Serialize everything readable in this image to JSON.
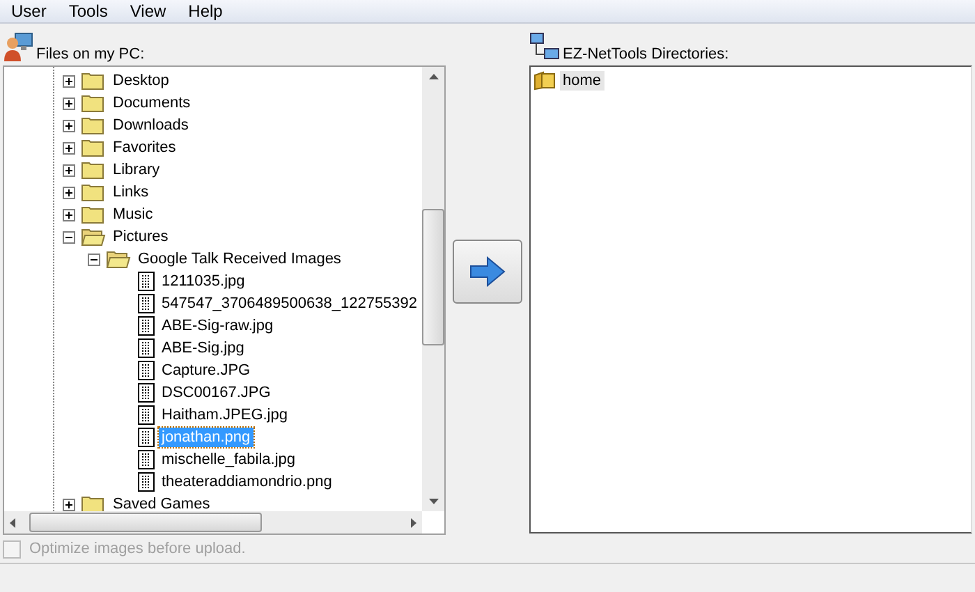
{
  "menu": [
    "User",
    "Tools",
    "View",
    "Help"
  ],
  "left_panel": {
    "label": "Files on my PC:",
    "tree": [
      {
        "label": "Desktop",
        "kind": "folder",
        "expanded": false,
        "selected": false
      },
      {
        "label": "Documents",
        "kind": "folder",
        "expanded": false,
        "selected": false
      },
      {
        "label": "Downloads",
        "kind": "folder",
        "expanded": false,
        "selected": false
      },
      {
        "label": "Favorites",
        "kind": "folder",
        "expanded": false,
        "selected": false
      },
      {
        "label": "Library",
        "kind": "folder",
        "expanded": false,
        "selected": false
      },
      {
        "label": "Links",
        "kind": "folder",
        "expanded": false,
        "selected": false
      },
      {
        "label": "Music",
        "kind": "folder",
        "expanded": false,
        "selected": false
      },
      {
        "label": "Pictures",
        "kind": "folder",
        "expanded": true,
        "selected": false,
        "children": [
          {
            "label": "Google Talk Received Images",
            "kind": "folder",
            "expanded": true,
            "selected": false,
            "children": [
              {
                "label": "1211035.jpg",
                "kind": "file",
                "selected": false
              },
              {
                "label": "547547_3706489500638_122755392",
                "kind": "file",
                "selected": false
              },
              {
                "label": "ABE-Sig-raw.jpg",
                "kind": "file",
                "selected": false
              },
              {
                "label": "ABE-Sig.jpg",
                "kind": "file",
                "selected": false
              },
              {
                "label": "Capture.JPG",
                "kind": "file",
                "selected": false
              },
              {
                "label": "DSC00167.JPG",
                "kind": "file",
                "selected": false
              },
              {
                "label": "Haitham.JPEG.jpg",
                "kind": "file",
                "selected": false
              },
              {
                "label": "jonathan.png",
                "kind": "file",
                "selected": true
              },
              {
                "label": "mischelle_fabila.jpg",
                "kind": "file",
                "selected": false
              },
              {
                "label": "theateraddiamondrio.png",
                "kind": "file",
                "selected": false
              }
            ]
          }
        ]
      },
      {
        "label": "Saved Games",
        "kind": "folder",
        "expanded": false,
        "selected": false
      }
    ]
  },
  "right_panel": {
    "label": "EZ-NetTools Directories:",
    "tree": [
      {
        "label": "home",
        "kind": "folder",
        "selected": true
      }
    ]
  },
  "optimize": {
    "label": "Optimize images before upload.",
    "checked": false,
    "disabled": true
  }
}
